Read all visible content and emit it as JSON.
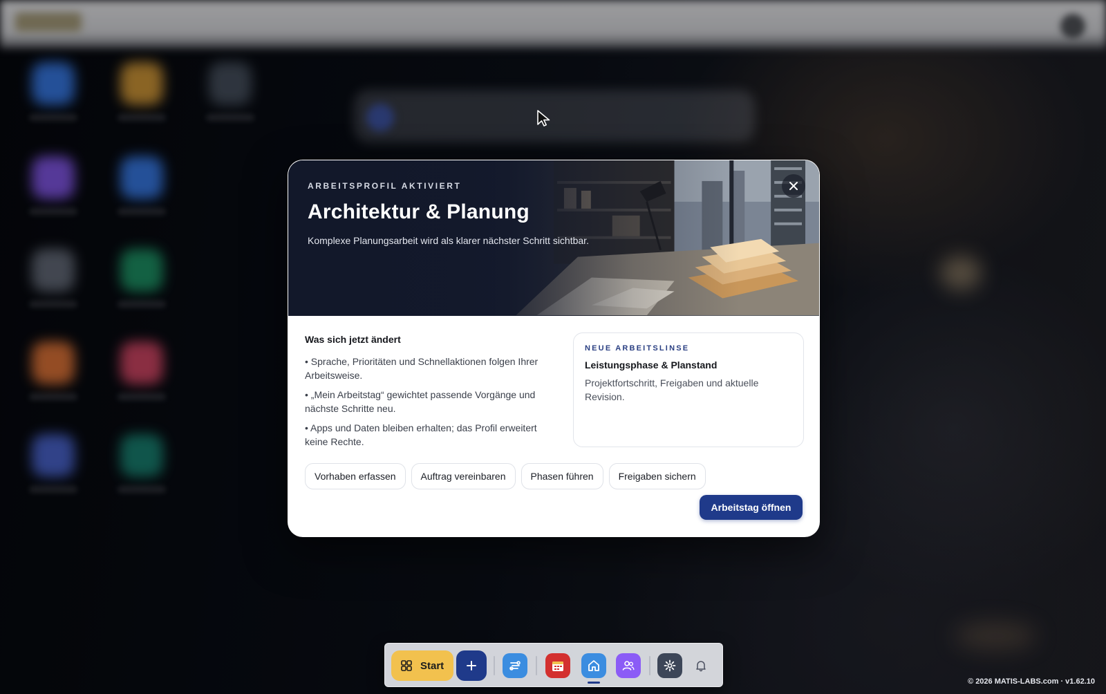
{
  "modal": {
    "kicker": "ARBEITSPROFIL AKTIVIERT",
    "title": "Architektur & Planung",
    "subtitle": "Komplexe Planungsarbeit wird als klarer nächster Schritt sichtbar.",
    "close_icon": "close-icon",
    "changes": {
      "title": "Was sich jetzt ändert",
      "items": [
        "• Sprache, Prioritäten und Schnellaktionen folgen Ihrer Arbeitsweise.",
        "• „Mein Arbeitstag“ gewichtet passende Vorgänge und nächste Schritte neu.",
        "• Apps und Daten bleiben erhalten; das Profil erweitert keine Rechte."
      ]
    },
    "lens": {
      "kicker": "NEUE ARBEITSLINSE",
      "title": "Leistungsphase & Planstand",
      "text": "Projektfortschritt, Freigaben und aktuelle Revision."
    },
    "chips": [
      "Vorhaben erfassen",
      "Auftrag vereinbaren",
      "Phasen führen",
      "Freigaben sichern"
    ],
    "cta_label": "Arbeitstag öffnen",
    "accent": "#1f3a8a"
  },
  "taskbar": {
    "start_label": "Start",
    "start_color": "#f2c14e",
    "icons": [
      "grid-icon",
      "plus-icon",
      "workflow-icon",
      "calendar-icon",
      "home-icon",
      "people-icon",
      "gear-icon",
      "bell-icon"
    ]
  },
  "footer": {
    "text": "© 2026 MATIS-LABS.com · v1.62.10"
  }
}
